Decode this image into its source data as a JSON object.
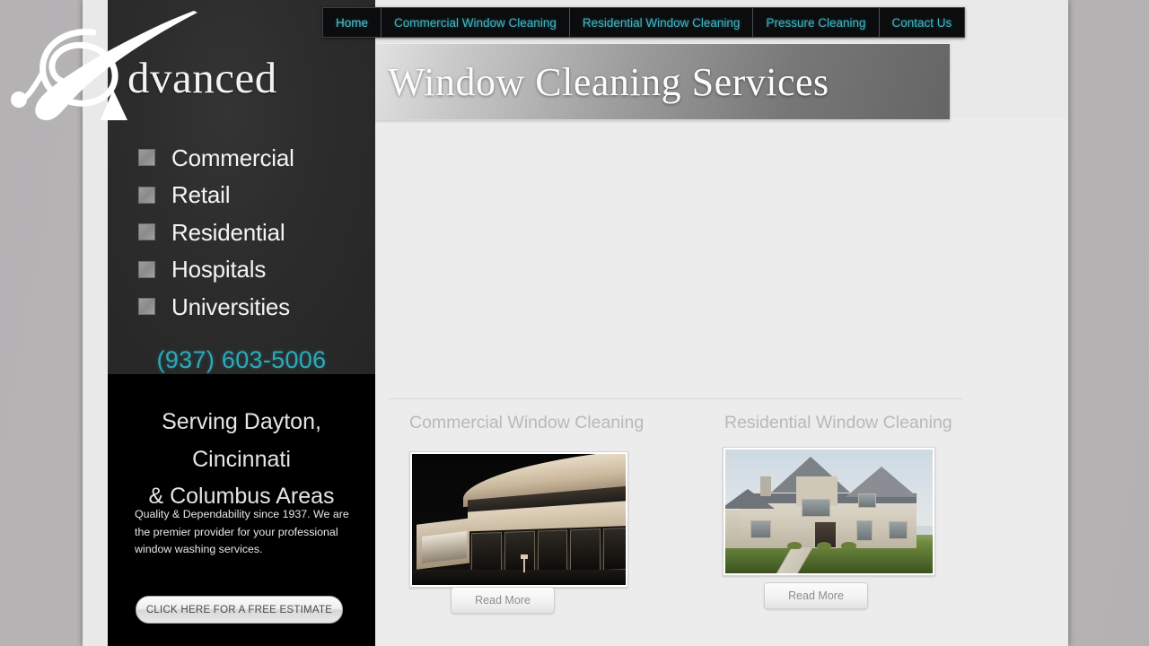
{
  "site": {
    "logo_script_letter": "A",
    "logo_word": "dvanced",
    "banner_title": "Window Cleaning Services"
  },
  "topnav": {
    "items": [
      {
        "label": "Home",
        "active": true
      },
      {
        "label": "Commercial Window Cleaning",
        "active": false
      },
      {
        "label": "Residential Window Cleaning",
        "active": false
      },
      {
        "label": "Pressure Cleaning",
        "active": false
      },
      {
        "label": "Contact Us",
        "active": false
      }
    ]
  },
  "sidebar": {
    "services": [
      {
        "label": "Commercial"
      },
      {
        "label": "Retail"
      },
      {
        "label": "Residential"
      },
      {
        "label": "Hospitals"
      },
      {
        "label": "Universities"
      }
    ],
    "phone": "(937) 603-5006",
    "serving_line1": "Serving Dayton, Cincinnati",
    "serving_line2": "& Columbus Areas",
    "blurb": "Quality & Dependability since 1937.   We are the premier provider for your professional window washing services.",
    "cta_label": "CLICK HERE FOR A FREE ESTIMATE"
  },
  "main": {
    "cards": [
      {
        "title": "Commercial Window Cleaning",
        "image_alt": "commercial-building-night-photo",
        "read_more_label": "Read More"
      },
      {
        "title": "Residential Window Cleaning",
        "image_alt": "suburban-house-photo",
        "read_more_label": "Read More"
      }
    ]
  },
  "colors": {
    "nav_text": "#3fb7c4",
    "phone_text": "#2fa8b8",
    "sidebar_bg": "#000000",
    "sidebar_top_bg": "#2c2c2c",
    "content_bg": "#ececec",
    "page_bg": "#b6b4b5",
    "card_title": "#b9b9b9"
  }
}
